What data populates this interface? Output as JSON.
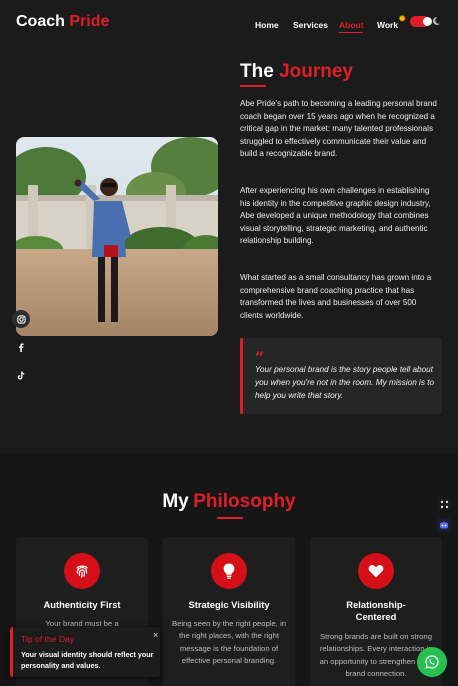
{
  "header": {
    "logo_main": "Coach",
    "logo_accent": "Pride",
    "nav": [
      {
        "label": "Home"
      },
      {
        "label": "Services"
      },
      {
        "label": "About"
      },
      {
        "label": "Work"
      }
    ],
    "active_nav": "About",
    "theme_toggle": {
      "state": "on"
    }
  },
  "journey": {
    "title_main": "The",
    "title_accent": "Journey",
    "paragraphs": [
      "Abe Pride's path to becoming a leading personal brand coach began over 15 years ago when he recognized a critical gap in the market: many talented professionals struggled to effectively communicate their value and build a recognizable brand.",
      "After experiencing his own challenges in establishing his identity in the competitive graphic design industry, Abe developed a unique methodology that combines visual storytelling, strategic marketing, and authentic relationship building.",
      "What started as a small consultancy has grown into a comprehensive brand coaching practice that has transformed the lives and businesses of over 500 clients worldwide."
    ],
    "quote_mark": "“",
    "quote": "Your personal brand is the story people tell about you when you're not in the room. My mission is to help you write that story."
  },
  "social": [
    {
      "icon": "instagram-icon"
    },
    {
      "icon": "facebook-icon"
    },
    {
      "icon": "tiktok-icon"
    }
  ],
  "philosophy": {
    "title_main": "My",
    "title_accent": "Philosophy",
    "cards": [
      {
        "icon": "fingerprint-icon",
        "title": "Authenticity First",
        "text": "Your brand must be a"
      },
      {
        "icon": "lightbulb-icon",
        "title": "Strategic Visibility",
        "text": "Being seen by the right people, in the right places, with the right message is the foundation of effective personal branding."
      },
      {
        "icon": "heart-icon",
        "title": "Relationship-Centered",
        "text": "Strong brands are built on strong relationships. Every interaction is an opportunity to strengthen your brand connection."
      }
    ]
  },
  "toast": {
    "title": "Tip of the Day",
    "text": "Your visual identity should reflect your personality and values.",
    "close": "×"
  },
  "colors": {
    "accent": "#e01e28",
    "background": "#1b1b1b",
    "whatsapp": "#27c152"
  }
}
